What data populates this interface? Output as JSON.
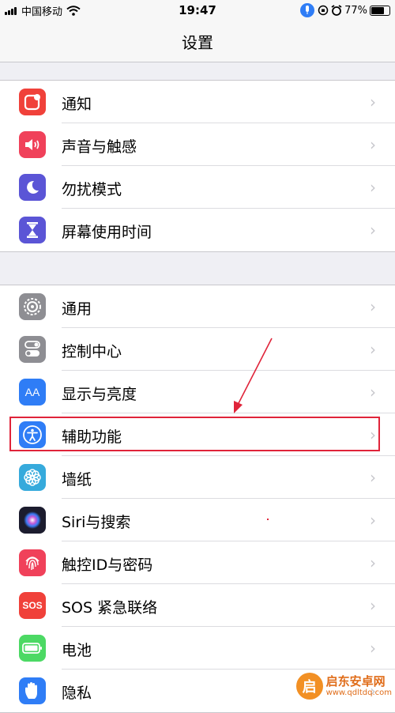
{
  "status_bar": {
    "carrier": "中国移动",
    "time": "19:47",
    "battery": "77%"
  },
  "navbar": {
    "title": "设置"
  },
  "groups": [
    {
      "items": [
        {
          "label": "通知",
          "icon": "notifications-icon",
          "color": "#f0413a"
        },
        {
          "label": "声音与触感",
          "icon": "sounds-icon",
          "color": "#f0415a"
        },
        {
          "label": "勿扰模式",
          "icon": "do-not-disturb-icon",
          "color": "#5b55d6"
        },
        {
          "label": "屏幕使用时间",
          "icon": "screen-time-icon",
          "color": "#5b55d6"
        }
      ]
    },
    {
      "items": [
        {
          "label": "通用",
          "icon": "gear-icon",
          "color": "#8e8e93"
        },
        {
          "label": "控制中心",
          "icon": "control-center-icon",
          "color": "#8e8e93"
        },
        {
          "label": "显示与亮度",
          "icon": "display-icon",
          "color": "#2f7df6"
        },
        {
          "label": "辅助功能",
          "icon": "accessibility-icon",
          "color": "#2f7df6"
        },
        {
          "label": "墙纸",
          "icon": "wallpaper-icon",
          "color": "#36aadc"
        },
        {
          "label": "Siri与搜索",
          "icon": "siri-icon",
          "color": "#1c1c2e"
        },
        {
          "label": "触控ID与密码",
          "icon": "touch-id-icon",
          "color": "#f0415a"
        },
        {
          "label": "SOS 紧急联络",
          "icon": "sos-icon",
          "color": "#f0413a"
        },
        {
          "label": "电池",
          "icon": "battery-icon",
          "color": "#4cd964"
        },
        {
          "label": "隐私",
          "icon": "privacy-icon",
          "color": "#2f7df6"
        }
      ]
    }
  ],
  "icon_text": {
    "display": "AA",
    "sos": "SOS"
  },
  "watermark": {
    "logo_char": "启",
    "name": "启东安卓网",
    "url": "www.qdltdq.com"
  },
  "chevron": "›"
}
